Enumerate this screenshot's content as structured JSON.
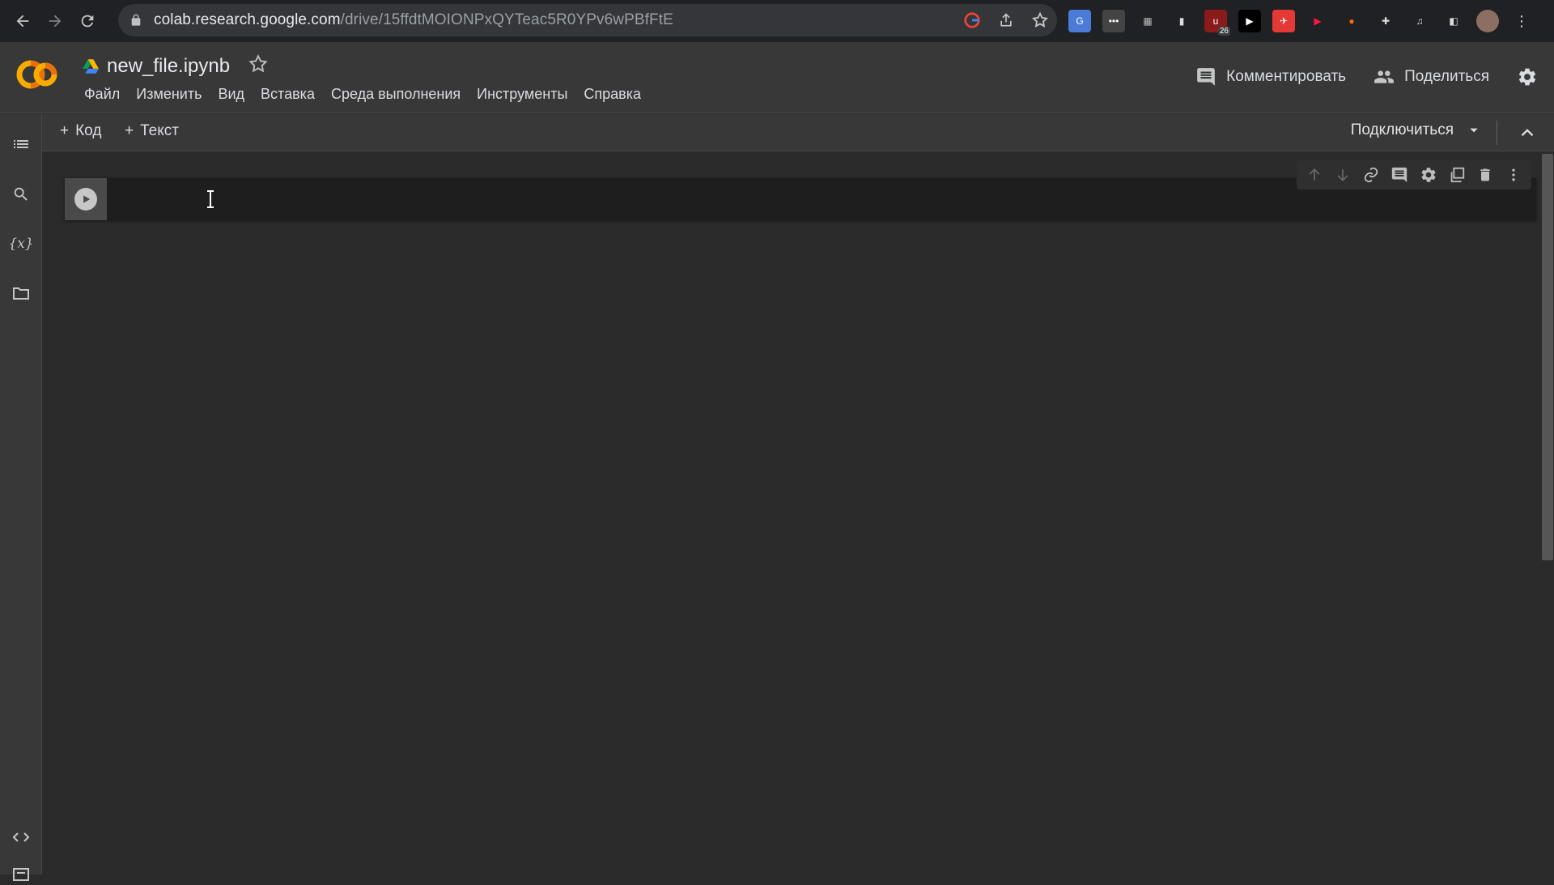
{
  "browser": {
    "url_host": "colab.research.google.com",
    "url_path": "/drive/15ffdtMOIONPxQYTeac5R0YPv6wPBfFtE",
    "extension_badge": "26"
  },
  "header": {
    "file_name": "new_file.ipynb",
    "menu": [
      "Файл",
      "Изменить",
      "Вид",
      "Вставка",
      "Среда выполнения",
      "Инструменты",
      "Справка"
    ],
    "comment_label": "Комментировать",
    "share_label": "Поделиться"
  },
  "toolbar": {
    "add_code_label": "Код",
    "add_text_label": "Текст",
    "connect_label": "Подключиться"
  },
  "rail": {
    "variables_glyph": "{x}"
  },
  "colors": {
    "accent_orange": "#F9AB00",
    "accent_orange_dark": "#E8710A"
  }
}
